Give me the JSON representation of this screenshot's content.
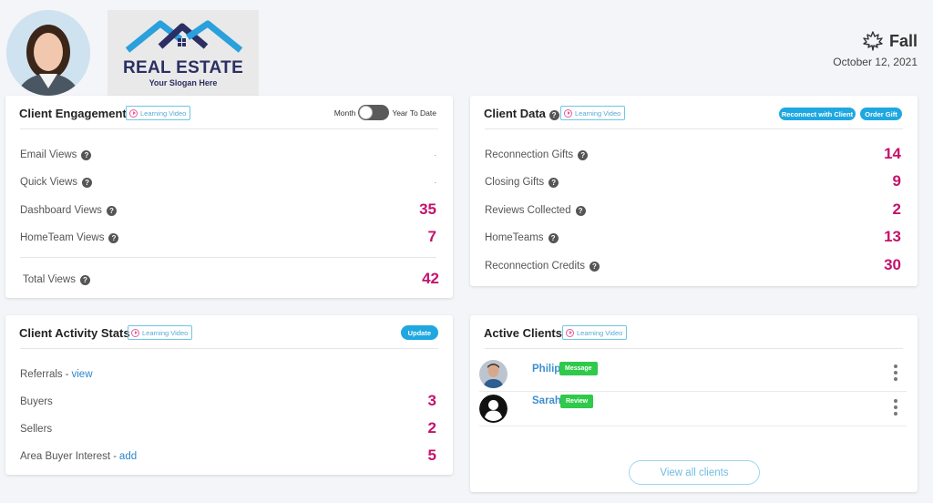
{
  "header": {
    "logo": {
      "title": "REAL ESTATE",
      "slogan": "Your Slogan Here"
    },
    "season": "Fall",
    "season_icon": "maple-leaf-icon",
    "date": "October 12, 2021"
  },
  "learning_video_label": "Learning Video",
  "engagement": {
    "title": "Client Engagement",
    "toggle": {
      "left_label": "Month",
      "right_label": "Year To Date"
    },
    "rows": [
      {
        "label": "Email Views",
        "value": "."
      },
      {
        "label": "Quick Views",
        "value": "."
      },
      {
        "label": "Dashboard Views",
        "value": "35"
      },
      {
        "label": "HomeTeam Views",
        "value": "7"
      }
    ],
    "total": {
      "label": "Total Views",
      "value": "42"
    }
  },
  "client_data": {
    "title": "Client Data",
    "reconnect_button": "Reconnect with Client",
    "order_gift_button": "Order Gift",
    "rows": [
      {
        "label": "Reconnection Gifts",
        "value": "14"
      },
      {
        "label": "Closing Gifts",
        "value": "9"
      },
      {
        "label": "Reviews Collected",
        "value": "2"
      },
      {
        "label": "HomeTeams",
        "value": "13"
      },
      {
        "label": "Reconnection Credits",
        "value": "30"
      }
    ]
  },
  "activity": {
    "title": "Client Activity Stats",
    "update_button": "Update",
    "referrals": {
      "label": "Referrals",
      "separator": "-",
      "link": "view"
    },
    "buyers": {
      "label": "Buyers",
      "value": "3"
    },
    "sellers": {
      "label": "Sellers",
      "value": "2"
    },
    "area_interest": {
      "label": "Area Buyer Interest",
      "separator": "-",
      "link": "add",
      "value": "5"
    }
  },
  "active_clients": {
    "title": "Active Clients",
    "clients": [
      {
        "name": "Philip",
        "badge": "Message",
        "avatar": "photo"
      },
      {
        "name": "Sarah",
        "badge": "Review",
        "avatar": "user-silhouette-icon"
      }
    ],
    "view_all": "View all clients"
  },
  "colors": {
    "accent_value": "#c3136c",
    "link": "#2e86c9",
    "pill_blue": "#1fa8e0",
    "badge_green": "#2fc94c",
    "logo_blue": "#2b2f63"
  }
}
